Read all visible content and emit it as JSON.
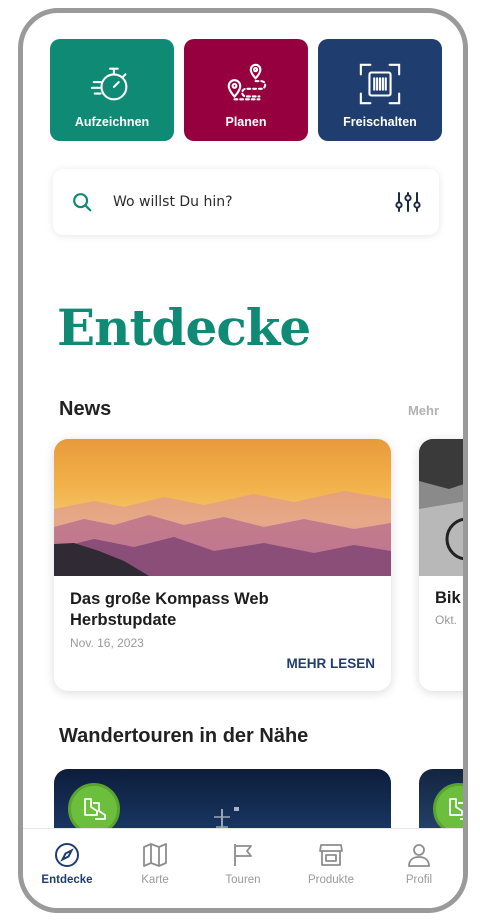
{
  "actions": [
    {
      "label": "Aufzeichnen",
      "icon": "stopwatch-icon",
      "color": "#0f8a74"
    },
    {
      "label": "Planen",
      "icon": "route-planner-icon",
      "color": "#96003f"
    },
    {
      "label": "Freischalten",
      "icon": "barcode-scan-icon",
      "color": "#1f3d6e"
    }
  ],
  "search": {
    "placeholder": "Wo willst Du hin?",
    "icon": "search-icon",
    "filter_icon": "filter-sliders-icon"
  },
  "heading": "Entdecke",
  "news": {
    "title": "News",
    "more": "Mehr",
    "items": [
      {
        "title": "Das große Kompass Web Herbstupdate",
        "date": "Nov. 16, 2023",
        "cta": "MEHR LESEN"
      },
      {
        "title": "Bik",
        "date": "Okt."
      }
    ]
  },
  "tours": {
    "title": "Wandertouren in der Nähe",
    "badge_icon": "hiking-boots-icon"
  },
  "tabs": [
    {
      "label": "Entdecke",
      "icon": "compass-icon",
      "active": true
    },
    {
      "label": "Karte",
      "icon": "map-icon",
      "active": false
    },
    {
      "label": "Touren",
      "icon": "flag-icon",
      "active": false
    },
    {
      "label": "Produkte",
      "icon": "store-icon",
      "active": false
    },
    {
      "label": "Profil",
      "icon": "user-icon",
      "active": false
    }
  ],
  "colors": {
    "primary": "#0f8a74",
    "navy": "#1f3d6e",
    "berry": "#96003f",
    "muted": "#9a9a9a"
  }
}
